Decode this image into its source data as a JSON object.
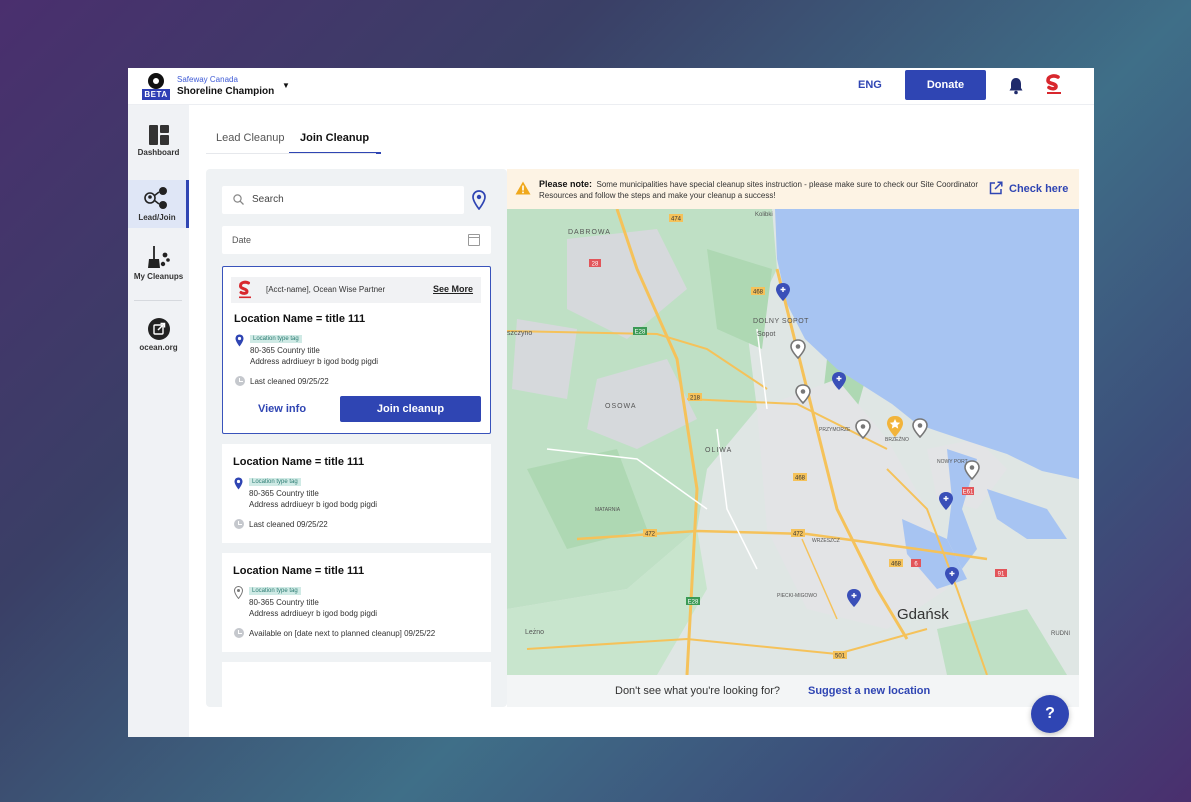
{
  "header": {
    "beta_badge": "BETA",
    "org": "Safeway Canada",
    "title": "Shoreline Champion",
    "language": "ENG",
    "donate_label": "Donate"
  },
  "sidebar": {
    "items": [
      {
        "label": "Dashboard"
      },
      {
        "label": "Lead/Join"
      },
      {
        "label": "My Cleanups"
      },
      {
        "label": "ocean.org"
      }
    ]
  },
  "tabs": [
    {
      "label": "Lead Cleanup",
      "active": false
    },
    {
      "label": "Join Cleanup",
      "active": true
    }
  ],
  "search": {
    "placeholder": "Search"
  },
  "date": {
    "placeholder": "Date"
  },
  "cards": [
    {
      "partner": "[Acct-name], Ocean Wise Partner",
      "see_more": "See More",
      "title": "Location Name = title 111",
      "tag": "Location type tag",
      "addr1": "80-365  Country title",
      "addr2": "Address adrdiueyr b igod bodg pigdi",
      "cleaned": "Last cleaned   09/25/22",
      "view_label": "View info",
      "join_label": "Join cleanup"
    },
    {
      "title": "Location Name = title 111",
      "tag": "Location type tag",
      "addr1": "80-365  Country title",
      "addr2": "Address adrdiueyr b igod bodg pigdi",
      "cleaned": "Last cleaned   09/25/22"
    },
    {
      "title": "Location Name = title 111",
      "tag": "Location type tag",
      "addr1": "80-365  Country title",
      "addr2": "Address adrdiueyr b igod bodg pigdi",
      "cleaned": "Available on [date next to planned cleanup]  09/25/22"
    }
  ],
  "notice": {
    "bold": "Please note:",
    "text": "Some municipalities have special cleanup sites instruction - please make sure to check our Site Coordinator Resources and follow the steps and make your cleanup a success!",
    "link": "Check here"
  },
  "map": {
    "places": {
      "dabrowa": "DABROWA",
      "kolibki": "Kolibki",
      "dolny_sopot": "DOLNY SOPOT",
      "sopot": "Sopot",
      "szczyno": "szczyno",
      "osowa": "OSOWA",
      "oliwa": "OLIWA",
      "przymorze": "PRZYMORZE",
      "brzezno": "BRZEŹNO",
      "nowy_port": "NOWY PORT",
      "matarnia": "MATARNIA",
      "wrzeszcz": "WRZESZCZ",
      "piecki": "PIECKI-MIGOWO",
      "gdansk": "Gdańsk",
      "rudni": "RUDNI",
      "lezno": "Leżno"
    },
    "roads": {
      "r474": "474",
      "r28": "28",
      "r468a": "468",
      "e28": "E28",
      "r218": "218",
      "r468b": "468",
      "r472a": "472",
      "r472b": "472",
      "e61": "E61",
      "r468c": "468",
      "r6": "6",
      "r91": "91",
      "e28b": "E28",
      "r501": "501"
    }
  },
  "suggest": {
    "question": "Don't see what you're looking for?",
    "link": "Suggest a new location"
  },
  "help_label": "?",
  "colors": {
    "primary": "#2f45b3",
    "tag_bg": "#cfeae5",
    "notice_bg": "#fdf3e4",
    "water": "#a7c4f2",
    "star_marker": "#f2b43a"
  }
}
